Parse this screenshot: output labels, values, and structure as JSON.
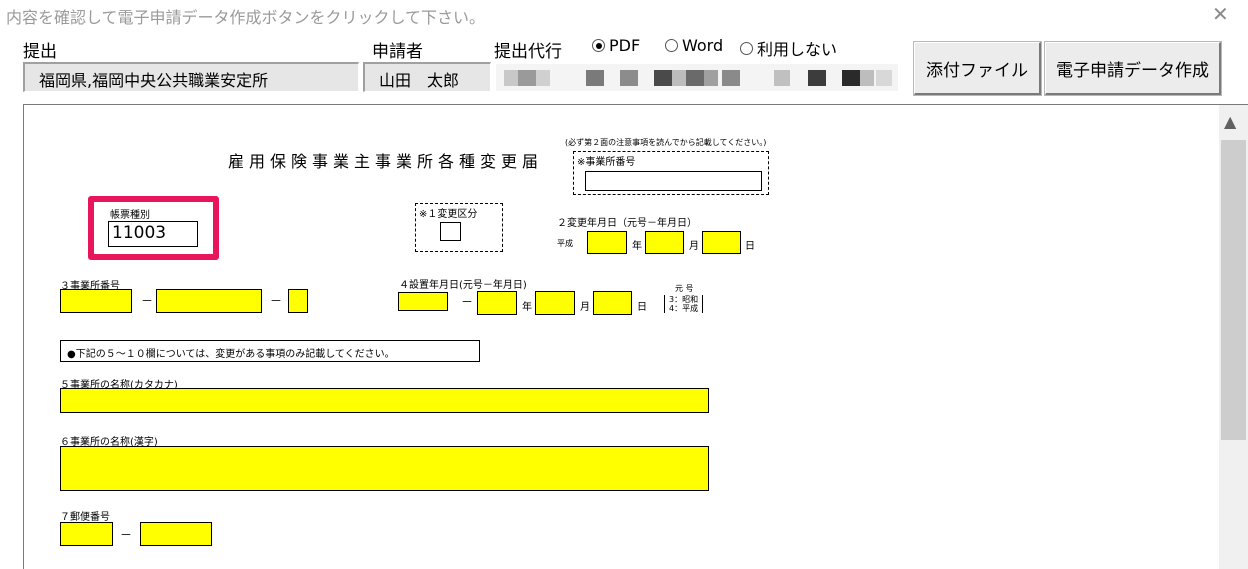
{
  "window": {
    "title": "内容を確認して電子申請データ作成ボタンをクリックして下さい。",
    "close_glyph": "✕"
  },
  "header": {
    "submit_label": "提出",
    "submit_value": "福岡県,福岡中央公共職業安定所",
    "applicant_label": "申請者",
    "applicant_value": "山田　太郎",
    "agent_label": "提出代行",
    "output_options": [
      {
        "label": "PDF",
        "selected": true
      },
      {
        "label": "Word",
        "selected": false
      },
      {
        "label": "利用しない",
        "selected": false
      }
    ],
    "attach_button": "添付ファイル",
    "create_button": "電子申請データ作成"
  },
  "form": {
    "title": "雇用保険事業主事業所各種変更届",
    "note_top": "(必ず第２面の注意事項を読んでから記載してください。)",
    "office_number_top_label": "※事業所番号",
    "form_type_label": "帳票種別",
    "form_type_value": "11003",
    "change_class_label": "※１変更区分",
    "change_date_label": "２変更年月日（元号－年月日）",
    "era_heisei": "平成",
    "year": "年",
    "month": "月",
    "day": "日",
    "office_number_label": "３事業所番号",
    "dash": "－",
    "setup_date_label": "４設置年月日(元号－年月日)",
    "era_header": "元 号",
    "era_options": "3：昭和\n4：平成",
    "notice": "●下記の５～１０欄については、変更がある事項のみ記載してください。",
    "name_kana_label": "５事業所の名称(カタカナ)",
    "name_kanji_label": "６事業所の名称(漢字)",
    "postal_label": "７郵便番号"
  },
  "scroll": {
    "up_glyph": "▲"
  }
}
